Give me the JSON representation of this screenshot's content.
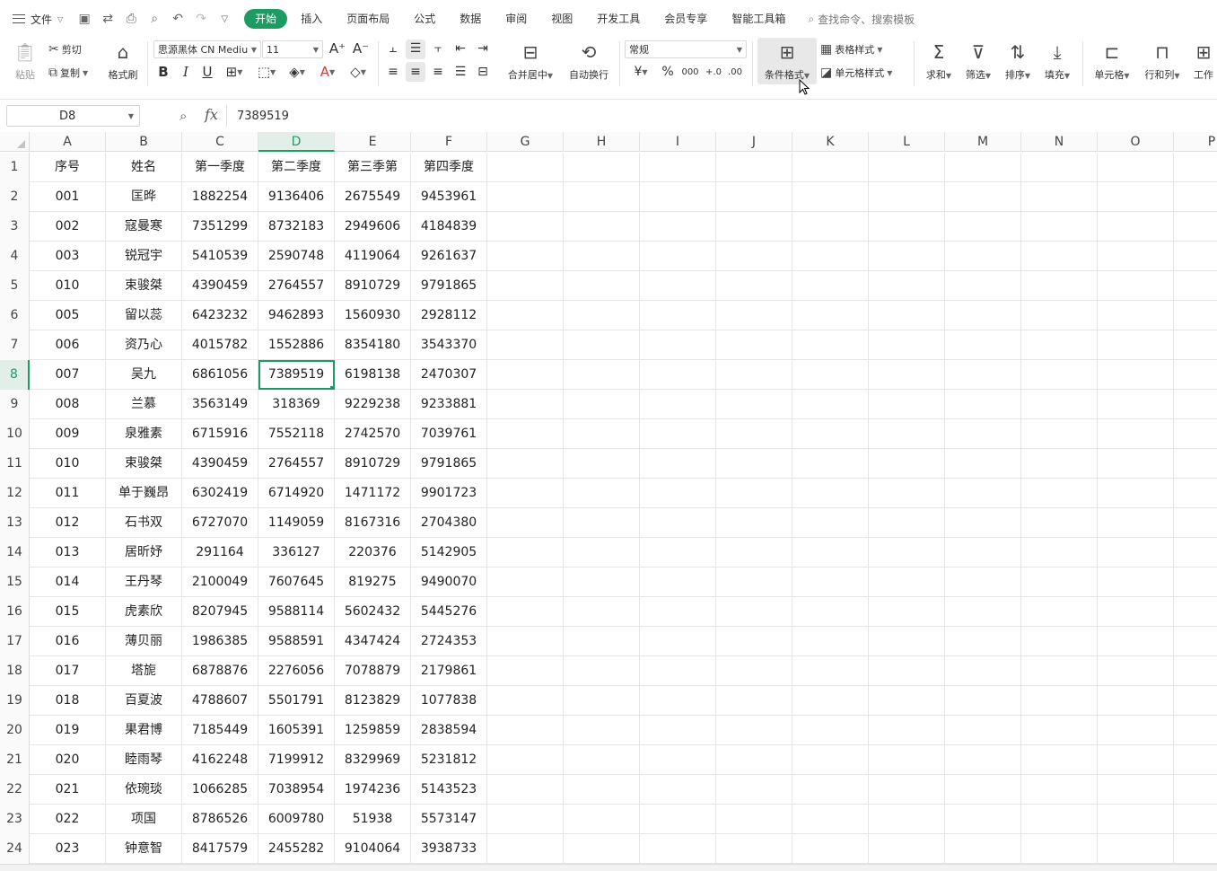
{
  "menubar": {
    "file_label": "文件",
    "tabs": [
      "开始",
      "插入",
      "页面布局",
      "公式",
      "数据",
      "审阅",
      "视图",
      "开发工具",
      "会员专享",
      "智能工具箱"
    ],
    "active_tab": "开始",
    "search_placeholder": "查找命令、搜索模板"
  },
  "ribbon": {
    "paste": "粘贴",
    "cut": "剪切",
    "copy": "复制",
    "format_painter": "格式刷",
    "font_name": "思源黑体 CN Mediu",
    "font_size": "11",
    "merge_center": "合并居中",
    "wrap_text": "自动换行",
    "number_format": "常规",
    "conditional_format": "条件格式",
    "table_style": "表格样式",
    "cell_style": "单元格样式",
    "sum": "求和",
    "filter": "筛选",
    "sort": "排序",
    "fill": "填充",
    "cell": "单元格",
    "row_col": "行和列",
    "worksheet": "工作"
  },
  "formula": {
    "name_box": "D8",
    "fx": "fx",
    "value": "7389519"
  },
  "columns": [
    "A",
    "B",
    "C",
    "D",
    "E",
    "F",
    "G",
    "H",
    "I",
    "J",
    "K",
    "L",
    "M",
    "N",
    "O",
    "P"
  ],
  "selected_column": "D",
  "selected_row": "8",
  "rows": [
    {
      "n": "1",
      "cells": [
        "序号",
        "姓名",
        "第一季度",
        "第二季度",
        "第三季第",
        "第四季度"
      ]
    },
    {
      "n": "2",
      "cells": [
        "001",
        "匡晔",
        "1882254",
        "9136406",
        "2675549",
        "9453961"
      ]
    },
    {
      "n": "3",
      "cells": [
        "002",
        "寇曼寒",
        "7351299",
        "8732183",
        "2949606",
        "4184839"
      ]
    },
    {
      "n": "4",
      "cells": [
        "003",
        "锐冠宇",
        "5410539",
        "2590748",
        "4119064",
        "9261637"
      ]
    },
    {
      "n": "5",
      "cells": [
        "010",
        "束骏桀",
        "4390459",
        "2764557",
        "8910729",
        "9791865"
      ]
    },
    {
      "n": "6",
      "cells": [
        "005",
        "留以蕊",
        "6423232",
        "9462893",
        "1560930",
        "2928112"
      ]
    },
    {
      "n": "7",
      "cells": [
        "006",
        "资乃心",
        "4015782",
        "1552886",
        "8354180",
        "3543370"
      ]
    },
    {
      "n": "8",
      "cells": [
        "007",
        "吴九",
        "6861056",
        "7389519",
        "6198138",
        "2470307"
      ]
    },
    {
      "n": "9",
      "cells": [
        "008",
        "兰慕",
        "3563149",
        "318369",
        "9229238",
        "9233881"
      ]
    },
    {
      "n": "10",
      "cells": [
        "009",
        "泉雅素",
        "6715916",
        "7552118",
        "2742570",
        "7039761"
      ]
    },
    {
      "n": "11",
      "cells": [
        "010",
        "束骏桀",
        "4390459",
        "2764557",
        "8910729",
        "9791865"
      ]
    },
    {
      "n": "12",
      "cells": [
        "011",
        "单于巍昂",
        "6302419",
        "6714920",
        "1471172",
        "9901723"
      ]
    },
    {
      "n": "13",
      "cells": [
        "012",
        "石书双",
        "6727070",
        "1149059",
        "8167316",
        "2704380"
      ]
    },
    {
      "n": "14",
      "cells": [
        "013",
        "居昕妤",
        "291164",
        "336127",
        "220376",
        "5142905"
      ]
    },
    {
      "n": "15",
      "cells": [
        "014",
        "王丹琴",
        "2100049",
        "7607645",
        "819275",
        "9490070"
      ]
    },
    {
      "n": "16",
      "cells": [
        "015",
        "虎素欣",
        "8207945",
        "9588114",
        "5602432",
        "5445276"
      ]
    },
    {
      "n": "17",
      "cells": [
        "016",
        "薄贝丽",
        "1986385",
        "9588591",
        "4347424",
        "2724353"
      ]
    },
    {
      "n": "18",
      "cells": [
        "017",
        "塔旎",
        "6878876",
        "2276056",
        "7078879",
        "2179861"
      ]
    },
    {
      "n": "19",
      "cells": [
        "018",
        "百夏波",
        "4788607",
        "5501791",
        "8123829",
        "1077838"
      ]
    },
    {
      "n": "20",
      "cells": [
        "019",
        "果君博",
        "7185449",
        "1605391",
        "1259859",
        "2838594"
      ]
    },
    {
      "n": "21",
      "cells": [
        "020",
        "睦雨琴",
        "4162248",
        "7199912",
        "8329969",
        "5231812"
      ]
    },
    {
      "n": "22",
      "cells": [
        "021",
        "依琬琰",
        "1066285",
        "7038954",
        "1974236",
        "5143523"
      ]
    },
    {
      "n": "23",
      "cells": [
        "022",
        "项国",
        "8786526",
        "6009780",
        "51938",
        "5573147"
      ]
    },
    {
      "n": "24",
      "cells": [
        "023",
        "钟意智",
        "8417579",
        "2455282",
        "9104064",
        "3938733"
      ]
    }
  ]
}
